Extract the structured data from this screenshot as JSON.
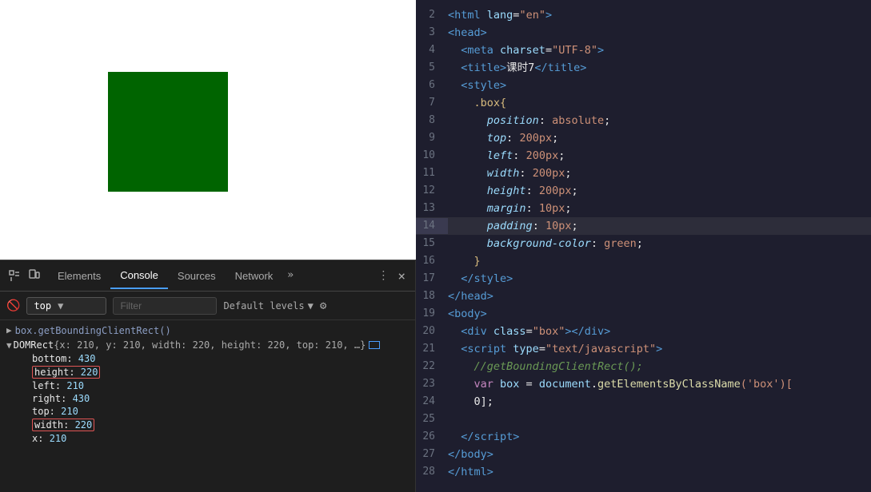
{
  "devtools": {
    "tabs": [
      {
        "label": "Elements",
        "active": false
      },
      {
        "label": "Console",
        "active": true
      },
      {
        "label": "Sources",
        "active": false
      },
      {
        "label": "Network",
        "active": false
      }
    ],
    "more_label": "»",
    "console_prompt": "top",
    "filter_placeholder": "Filter",
    "default_levels_label": "Default levels",
    "close_label": "×"
  },
  "console": {
    "call_line": "box.getBoundingClientRect()",
    "domrect_label": "DOMRect",
    "domrect_inline": "{x: 210, y: 210, width: 220, height: 220, top: 210, …}",
    "props": [
      {
        "name": "bottom",
        "value": "430",
        "highlighted": false
      },
      {
        "name": "height",
        "value": "220",
        "highlighted": true
      },
      {
        "name": "left",
        "value": "210",
        "highlighted": false
      },
      {
        "name": "right",
        "value": "430",
        "highlighted": false
      },
      {
        "name": "top",
        "value": "210",
        "highlighted": false
      },
      {
        "name": "width",
        "value": "220",
        "highlighted": true
      },
      {
        "name": "x",
        "value": "210",
        "highlighted": false
      }
    ]
  },
  "code": {
    "lines": [
      {
        "num": 2,
        "tokens": [
          {
            "text": "<",
            "class": "tag"
          },
          {
            "text": "html",
            "class": "tag"
          },
          {
            "text": " lang",
            "class": "attr-name"
          },
          {
            "text": "=",
            "class": "css-punct"
          },
          {
            "text": "\"en\"",
            "class": "attr-value"
          },
          {
            "text": ">",
            "class": "tag"
          }
        ]
      },
      {
        "num": 3,
        "tokens": [
          {
            "text": "<",
            "class": "tag"
          },
          {
            "text": "head",
            "class": "tag"
          },
          {
            "text": ">",
            "class": "tag"
          }
        ]
      },
      {
        "num": 4,
        "tokens": [
          {
            "text": "  <",
            "class": "tag"
          },
          {
            "text": "meta",
            "class": "tag"
          },
          {
            "text": " charset",
            "class": "attr-name"
          },
          {
            "text": "=",
            "class": "css-punct"
          },
          {
            "text": "\"UTF-8\"",
            "class": "attr-value"
          },
          {
            "text": ">",
            "class": "tag"
          }
        ]
      },
      {
        "num": 5,
        "tokens": [
          {
            "text": "  <",
            "class": "tag"
          },
          {
            "text": "title",
            "class": "tag"
          },
          {
            "text": ">",
            "class": "tag"
          },
          {
            "text": "课时7",
            "class": "text-content"
          },
          {
            "text": "</",
            "class": "tag"
          },
          {
            "text": "title",
            "class": "tag"
          },
          {
            "text": ">",
            "class": "tag"
          }
        ]
      },
      {
        "num": 6,
        "tokens": [
          {
            "text": "  <",
            "class": "tag"
          },
          {
            "text": "style",
            "class": "tag"
          },
          {
            "text": ">",
            "class": "tag"
          }
        ]
      },
      {
        "num": 7,
        "tokens": [
          {
            "text": "    ",
            "class": ""
          },
          {
            "text": ".box{",
            "class": "css-selector"
          }
        ]
      },
      {
        "num": 8,
        "tokens": [
          {
            "text": "      ",
            "class": ""
          },
          {
            "text": "position",
            "class": "css-property"
          },
          {
            "text": ": ",
            "class": "css-punct"
          },
          {
            "text": "absolute",
            "class": "css-value"
          },
          {
            "text": ";",
            "class": "css-punct"
          }
        ]
      },
      {
        "num": 9,
        "tokens": [
          {
            "text": "      ",
            "class": ""
          },
          {
            "text": "top",
            "class": "css-property"
          },
          {
            "text": ": ",
            "class": "css-punct"
          },
          {
            "text": "200px",
            "class": "css-value"
          },
          {
            "text": ";",
            "class": "css-punct"
          }
        ]
      },
      {
        "num": 10,
        "tokens": [
          {
            "text": "      ",
            "class": ""
          },
          {
            "text": "left",
            "class": "css-property"
          },
          {
            "text": ": ",
            "class": "css-punct"
          },
          {
            "text": "200px",
            "class": "css-value"
          },
          {
            "text": ";",
            "class": "css-punct"
          }
        ]
      },
      {
        "num": 11,
        "tokens": [
          {
            "text": "      ",
            "class": ""
          },
          {
            "text": "width",
            "class": "css-property"
          },
          {
            "text": ": ",
            "class": "css-punct"
          },
          {
            "text": "200px",
            "class": "css-value"
          },
          {
            "text": ";",
            "class": "css-punct"
          }
        ]
      },
      {
        "num": 12,
        "tokens": [
          {
            "text": "      ",
            "class": ""
          },
          {
            "text": "height",
            "class": "css-property"
          },
          {
            "text": ": ",
            "class": "css-punct"
          },
          {
            "text": "200px",
            "class": "css-value"
          },
          {
            "text": ";",
            "class": "css-punct"
          }
        ]
      },
      {
        "num": 13,
        "tokens": [
          {
            "text": "      ",
            "class": ""
          },
          {
            "text": "margin",
            "class": "css-property"
          },
          {
            "text": ": ",
            "class": "css-punct"
          },
          {
            "text": "10px",
            "class": "css-value"
          },
          {
            "text": ";",
            "class": "css-punct"
          }
        ]
      },
      {
        "num": 14,
        "highlight": true,
        "tokens": [
          {
            "text": "      ",
            "class": ""
          },
          {
            "text": "padding",
            "class": "css-property"
          },
          {
            "text": ": ",
            "class": "css-punct"
          },
          {
            "text": "10px",
            "class": "css-value"
          },
          {
            "text": ";",
            "class": "css-punct"
          }
        ]
      },
      {
        "num": 15,
        "tokens": [
          {
            "text": "      ",
            "class": ""
          },
          {
            "text": "background-color",
            "class": "css-property"
          },
          {
            "text": ": ",
            "class": "css-punct"
          },
          {
            "text": "green",
            "class": "css-value"
          },
          {
            "text": ";",
            "class": "css-punct"
          }
        ]
      },
      {
        "num": 16,
        "tokens": [
          {
            "text": "    }",
            "class": "css-selector"
          }
        ]
      },
      {
        "num": 17,
        "tokens": [
          {
            "text": "  </",
            "class": "tag"
          },
          {
            "text": "style",
            "class": "tag"
          },
          {
            "text": ">",
            "class": "tag"
          }
        ]
      },
      {
        "num": 18,
        "tokens": [
          {
            "text": "</",
            "class": "tag"
          },
          {
            "text": "head",
            "class": "tag"
          },
          {
            "text": ">",
            "class": "tag"
          }
        ]
      },
      {
        "num": 19,
        "tokens": [
          {
            "text": "<",
            "class": "tag"
          },
          {
            "text": "body",
            "class": "tag"
          },
          {
            "text": ">",
            "class": "tag"
          }
        ]
      },
      {
        "num": 20,
        "tokens": [
          {
            "text": "  <",
            "class": "tag"
          },
          {
            "text": "div",
            "class": "tag"
          },
          {
            "text": " class",
            "class": "attr-name"
          },
          {
            "text": "=",
            "class": "css-punct"
          },
          {
            "text": "\"box\"",
            "class": "attr-value"
          },
          {
            "text": "></",
            "class": "tag"
          },
          {
            "text": "div",
            "class": "tag"
          },
          {
            "text": ">",
            "class": "tag"
          }
        ]
      },
      {
        "num": 21,
        "tokens": [
          {
            "text": "  <",
            "class": "tag"
          },
          {
            "text": "script",
            "class": "tag"
          },
          {
            "text": " type",
            "class": "attr-name"
          },
          {
            "text": "=",
            "class": "css-punct"
          },
          {
            "text": "\"text/javascript\"",
            "class": "attr-value"
          },
          {
            "text": ">",
            "class": "tag"
          }
        ]
      },
      {
        "num": 22,
        "tokens": [
          {
            "text": "    ",
            "class": ""
          },
          {
            "text": "//getBoundingClientRect();",
            "class": "comment"
          }
        ]
      },
      {
        "num": 23,
        "tokens": [
          {
            "text": "    ",
            "class": ""
          },
          {
            "text": "var",
            "class": "js-keyword"
          },
          {
            "text": " box ",
            "class": "js-var"
          },
          {
            "text": "= ",
            "class": "css-punct"
          },
          {
            "text": "document",
            "class": "js-var"
          },
          {
            "text": ".",
            "class": "css-punct"
          },
          {
            "text": "getElementsByClassName",
            "class": "js-method"
          },
          {
            "text": "('box')[",
            "class": "js-string"
          }
        ]
      },
      {
        "num": 24,
        "tokens": [
          {
            "text": "    0];",
            "class": "text-content"
          }
        ]
      },
      {
        "num": 25,
        "tokens": []
      },
      {
        "num": 26,
        "tokens": [
          {
            "text": "  </",
            "class": "tag"
          },
          {
            "text": "script",
            "class": "tag"
          },
          {
            "text": ">",
            "class": "tag"
          }
        ]
      },
      {
        "num": 27,
        "tokens": [
          {
            "text": "</",
            "class": "tag"
          },
          {
            "text": "body",
            "class": "tag"
          },
          {
            "text": ">",
            "class": "tag"
          }
        ]
      },
      {
        "num": 28,
        "tokens": [
          {
            "text": "</",
            "class": "tag"
          },
          {
            "text": "html",
            "class": "tag"
          },
          {
            "text": ">",
            "class": "tag"
          }
        ]
      }
    ]
  }
}
